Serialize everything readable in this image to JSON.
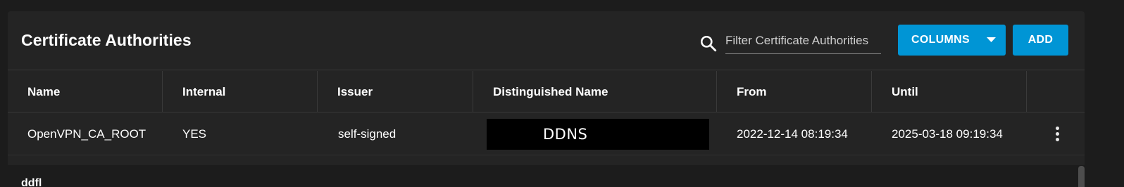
{
  "header": {
    "title": "Certificate Authorities",
    "filter_placeholder": "Filter Certificate Authorities",
    "columns_label": "COLUMNS",
    "add_label": "ADD"
  },
  "table": {
    "columns": [
      "Name",
      "Internal",
      "Issuer",
      "Distinguished Name",
      "From",
      "Until"
    ],
    "rows": [
      {
        "name": "OpenVPN_CA_ROOT",
        "internal": "YES",
        "issuer": "self-signed",
        "distinguished_name": "DDNS",
        "from": "2022-12-14 08:19:34",
        "until": "2025-03-18 09:19:34"
      }
    ]
  },
  "below_card_text": "ddfl",
  "colors": {
    "accent": "#0095d5",
    "card": "#242424",
    "background": "#1c1c1c"
  }
}
